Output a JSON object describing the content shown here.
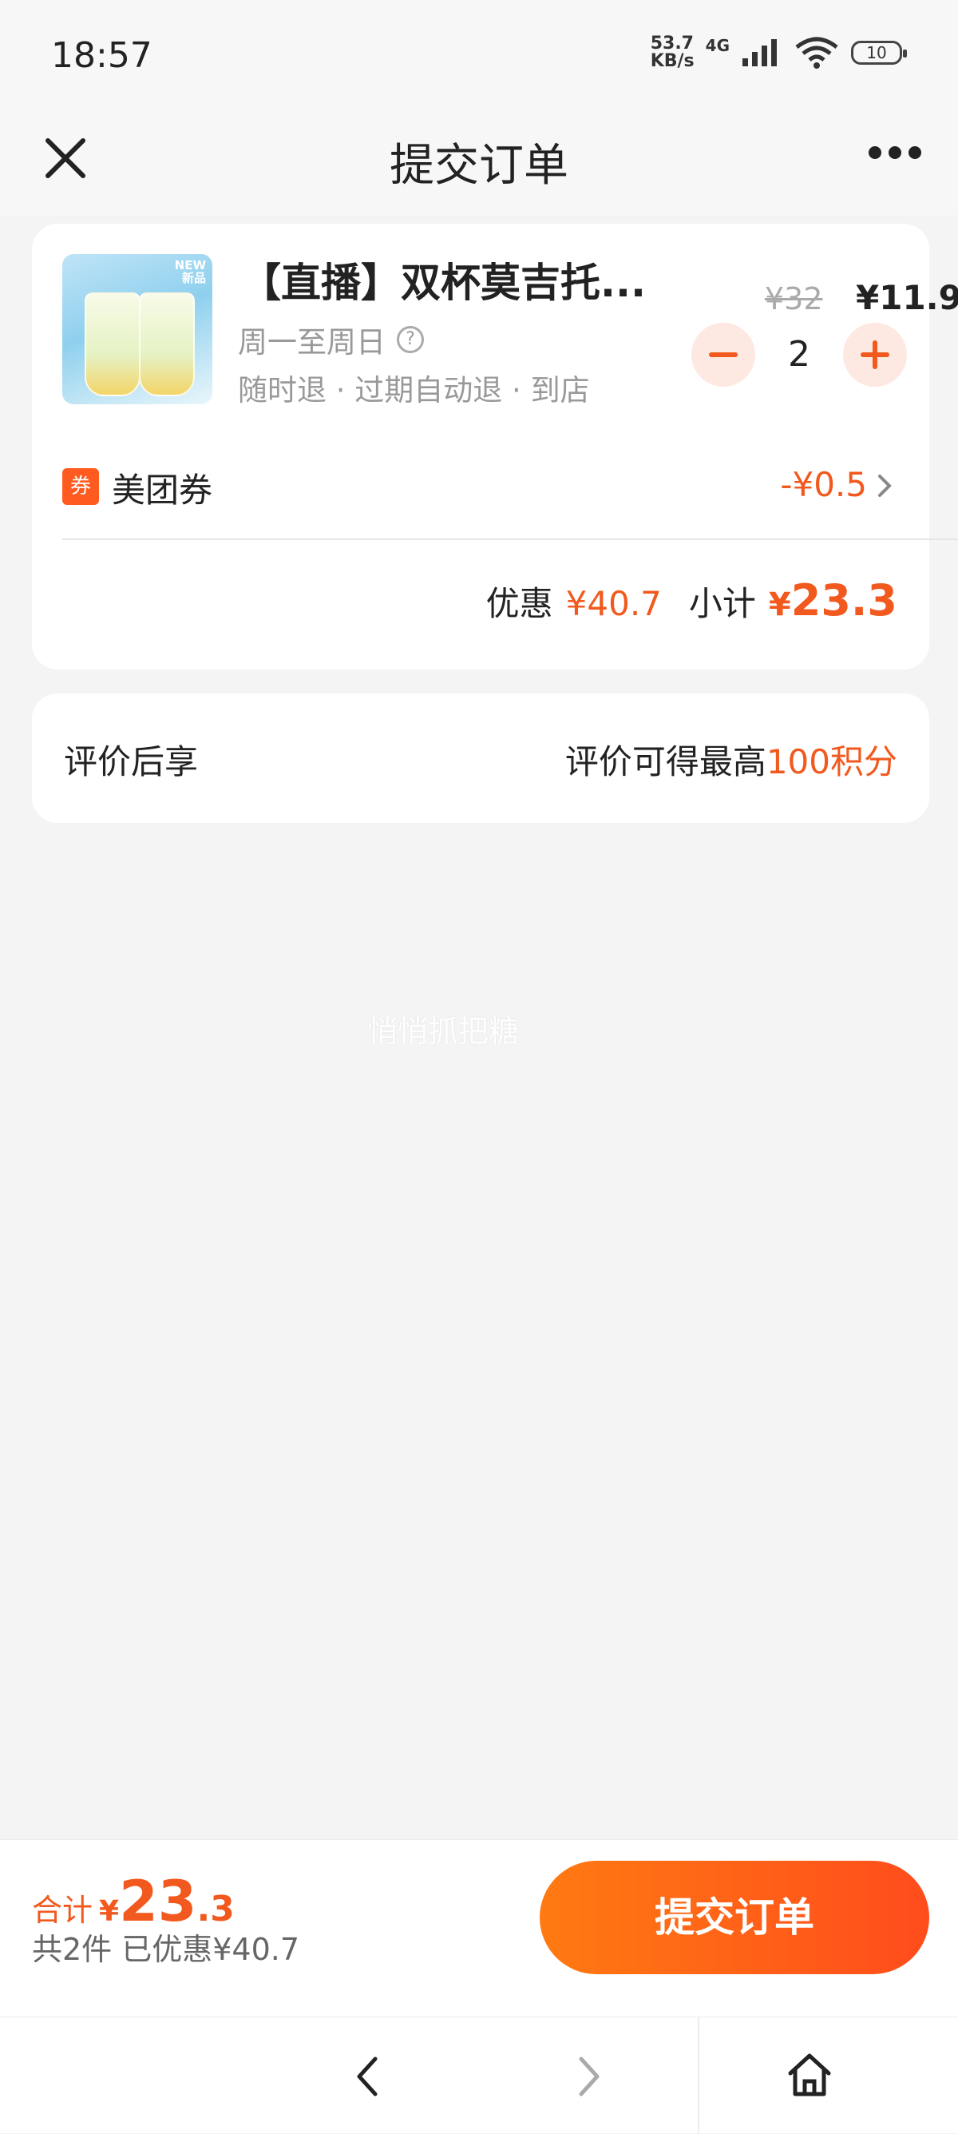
{
  "status_bar": {
    "time": "18:57",
    "net_speed_value": "53.7",
    "net_speed_unit": "KB/s",
    "network": "4G",
    "battery": "10"
  },
  "nav": {
    "title": "提交订单",
    "close_icon": "close-icon",
    "more_icon": "more-dots-icon"
  },
  "order": {
    "thumb_badge_line1": "NEW",
    "thumb_badge_line2": "新品",
    "product_title": "【直播】双杯莫吉托...",
    "days": "周一至周日",
    "tags": "随时退 · 过期自动退 · 到店",
    "original_price": "¥32",
    "current_price": "¥11.9",
    "quantity": "2",
    "coupon_icon_text": "券",
    "coupon_label": "美团券",
    "coupon_value": "-¥0.5",
    "discount_label": "优惠",
    "discount_value": "¥40.7",
    "subtotal_label": "小计",
    "subtotal_symbol": "¥",
    "subtotal_value": "23.3"
  },
  "review": {
    "left_label": "评价后享",
    "right_prefix": "评价可得最高",
    "right_highlight": "100积分"
  },
  "watermark": "悄悄抓把糖",
  "bottom": {
    "total_label": "合计",
    "total_symbol": "¥",
    "total_int": "23",
    "total_dec": ".3",
    "summary": "共2件  已优惠¥40.7",
    "submit_label": "提交订单"
  },
  "colors": {
    "accent": "#f2591e",
    "button_gradient_start": "#ff7a12",
    "button_gradient_end": "#ff4c1c"
  }
}
